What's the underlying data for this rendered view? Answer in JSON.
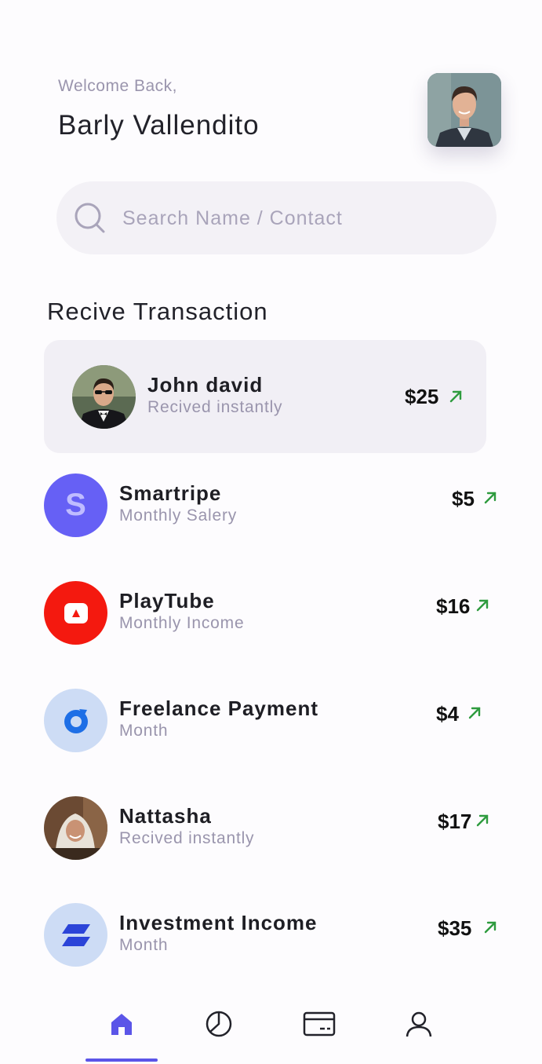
{
  "header": {
    "welcome": "Welcome Back,",
    "username": "Barly Vallendito",
    "avatar_icon": "user-photo"
  },
  "search": {
    "placeholder": "Search Name / Contact",
    "value": "",
    "icon": "search-icon"
  },
  "section": {
    "title": "Recive Transaction"
  },
  "transactions": [
    {
      "name": "John david",
      "subtitle": "Recived instantly",
      "amount": "$25",
      "avatar": "photo",
      "highlighted": true
    },
    {
      "name": "Smartripe",
      "subtitle": "Monthly Salery",
      "amount": "$5",
      "avatar": "letter-s",
      "avatar_letter": "S",
      "avatar_color": "#6660f5"
    },
    {
      "name": "PlayTube",
      "subtitle": "Monthly Income",
      "amount": "$16",
      "avatar": "playtube-logo",
      "avatar_color": "#f4190f"
    },
    {
      "name": "Freelance Payment",
      "subtitle": "Month",
      "amount": "$4",
      "avatar": "freelance-logo",
      "avatar_color": "#cddcf5"
    },
    {
      "name": "Nattasha",
      "subtitle": "Recived instantly",
      "amount": "$17",
      "avatar": "photo"
    },
    {
      "name": "Investment Income",
      "subtitle": "Month",
      "amount": "$35",
      "avatar": "investment-logo",
      "avatar_color": "#cddcf5"
    }
  ],
  "colors": {
    "accent": "#5b55e8",
    "up_arrow": "#2e9b3e",
    "muted_text": "#9a95ad",
    "highlight_bg": "#f1eff5"
  },
  "nav": {
    "items": [
      "home-icon",
      "chart-icon",
      "card-icon",
      "profile-icon"
    ],
    "active": "home-icon"
  }
}
